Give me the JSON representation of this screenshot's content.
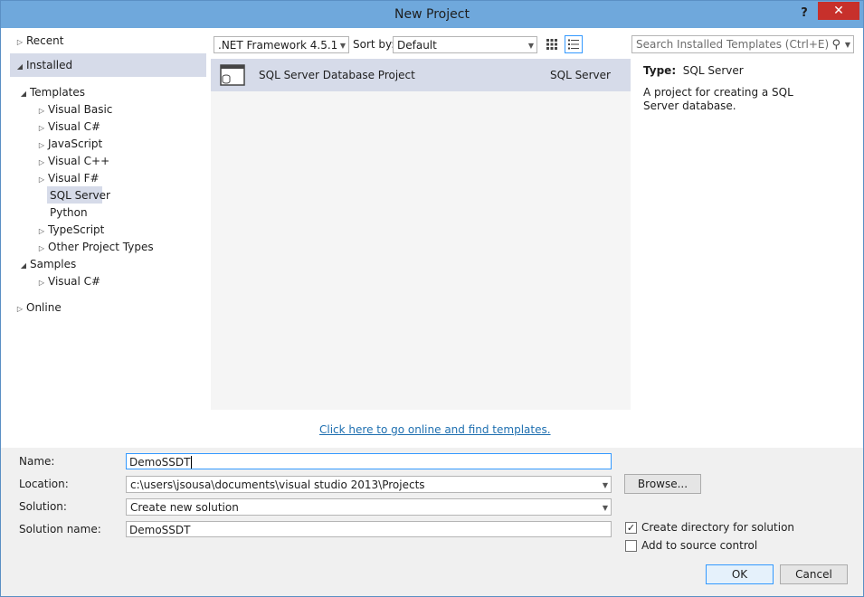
{
  "window": {
    "title": "New Project",
    "help_label": "?",
    "close_label": "✕"
  },
  "tree": {
    "recent": "Recent",
    "installed": "Installed",
    "templates": "Templates",
    "template_items": [
      "Visual Basic",
      "Visual C#",
      "JavaScript",
      "Visual C++",
      "Visual F#",
      "SQL Server",
      "Python",
      "TypeScript",
      "Other Project Types"
    ],
    "samples": "Samples",
    "sample_items": [
      "Visual C#"
    ],
    "online": "Online"
  },
  "toolbar": {
    "framework": ".NET Framework 4.5.1",
    "sort_label": "Sort by:",
    "sort_value": "Default",
    "search_placeholder": "Search Installed Templates (Ctrl+E)"
  },
  "templates_list": [
    {
      "name": "SQL Server Database Project",
      "language": "SQL Server"
    }
  ],
  "details": {
    "type_label": "Type:",
    "type_value": "SQL Server",
    "description": "A project for creating a SQL Server database."
  },
  "online_link": "Click here to go online and find templates.",
  "form": {
    "name_label": "Name:",
    "name_value": "DemoSSDT",
    "location_label": "Location:",
    "location_value": "c:\\users\\jsousa\\documents\\visual studio 2013\\Projects",
    "solution_label": "Solution:",
    "solution_value": "Create new solution",
    "solution_name_label": "Solution name:",
    "solution_name_value": "DemoSSDT",
    "browse_label": "Browse...",
    "create_dir_label": "Create directory for solution",
    "create_dir_checked": true,
    "source_control_label": "Add to source control",
    "source_control_checked": false
  },
  "buttons": {
    "ok": "OK",
    "cancel": "Cancel"
  }
}
